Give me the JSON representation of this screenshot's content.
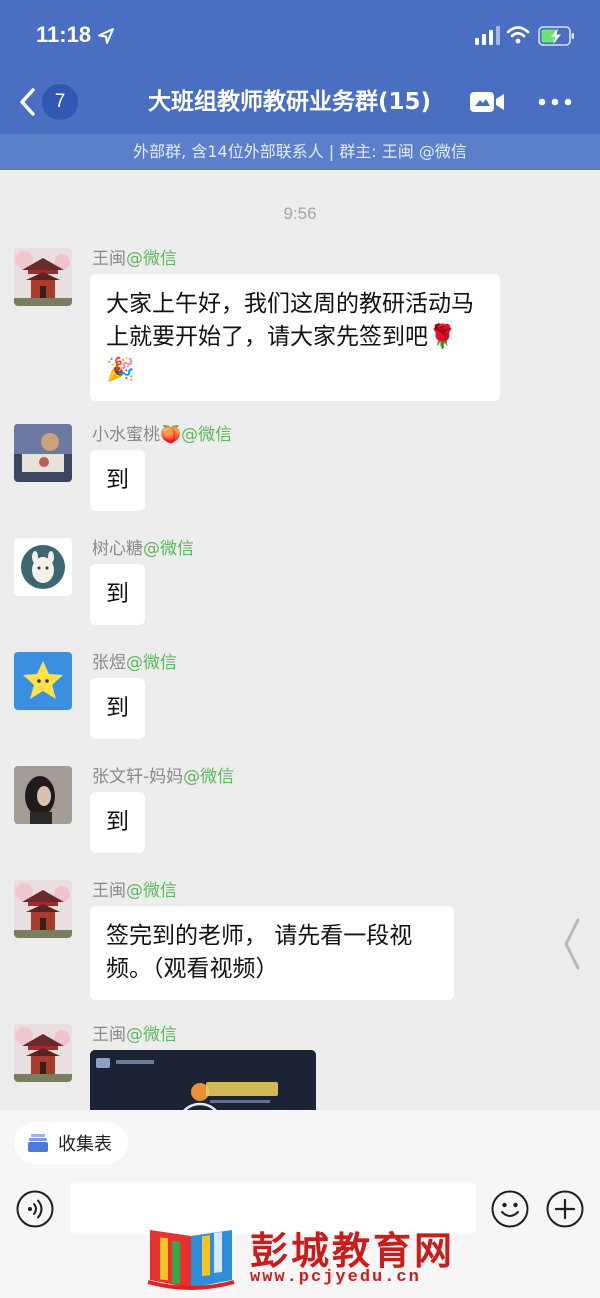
{
  "status_bar": {
    "time": "11:18"
  },
  "header": {
    "back_count": "7",
    "title": "大班组教师教研业务群(15)",
    "subtitle": "外部群, 含14位外部联系人 | 群主: 王闽 @微信"
  },
  "chat": {
    "timestamp": "9:56",
    "messages": [
      {
        "sender": "王闽",
        "source": "@微信",
        "text": "大家上午好，我们这周的教研活动马上就要开始了，请大家先签到吧🌹🎉"
      },
      {
        "sender": "小水蜜桃🍑",
        "source": "@微信",
        "text": "到"
      },
      {
        "sender": "树心糖",
        "source": "@微信",
        "text": "到"
      },
      {
        "sender": "张煜",
        "source": "@微信",
        "text": "到"
      },
      {
        "sender": "张文轩-妈妈",
        "source": "@微信",
        "text": "到"
      },
      {
        "sender": "王闽",
        "source": "@微信",
        "text": "签完到的老师， 请先看一段视频。（观看视频）"
      },
      {
        "sender": "王闽",
        "source": "@微信",
        "text": ""
      }
    ]
  },
  "bottom": {
    "collect_label": "收集表",
    "input_placeholder": ""
  },
  "watermark": {
    "title": "彭城教育网",
    "url": "www.pcjyedu.cn"
  },
  "colors": {
    "header": "#4a6fc2",
    "subbar": "#5c7fca",
    "chat_bg": "#ededed",
    "wechat_green": "#5cb85c",
    "watermark_red": "#c81d1d"
  }
}
